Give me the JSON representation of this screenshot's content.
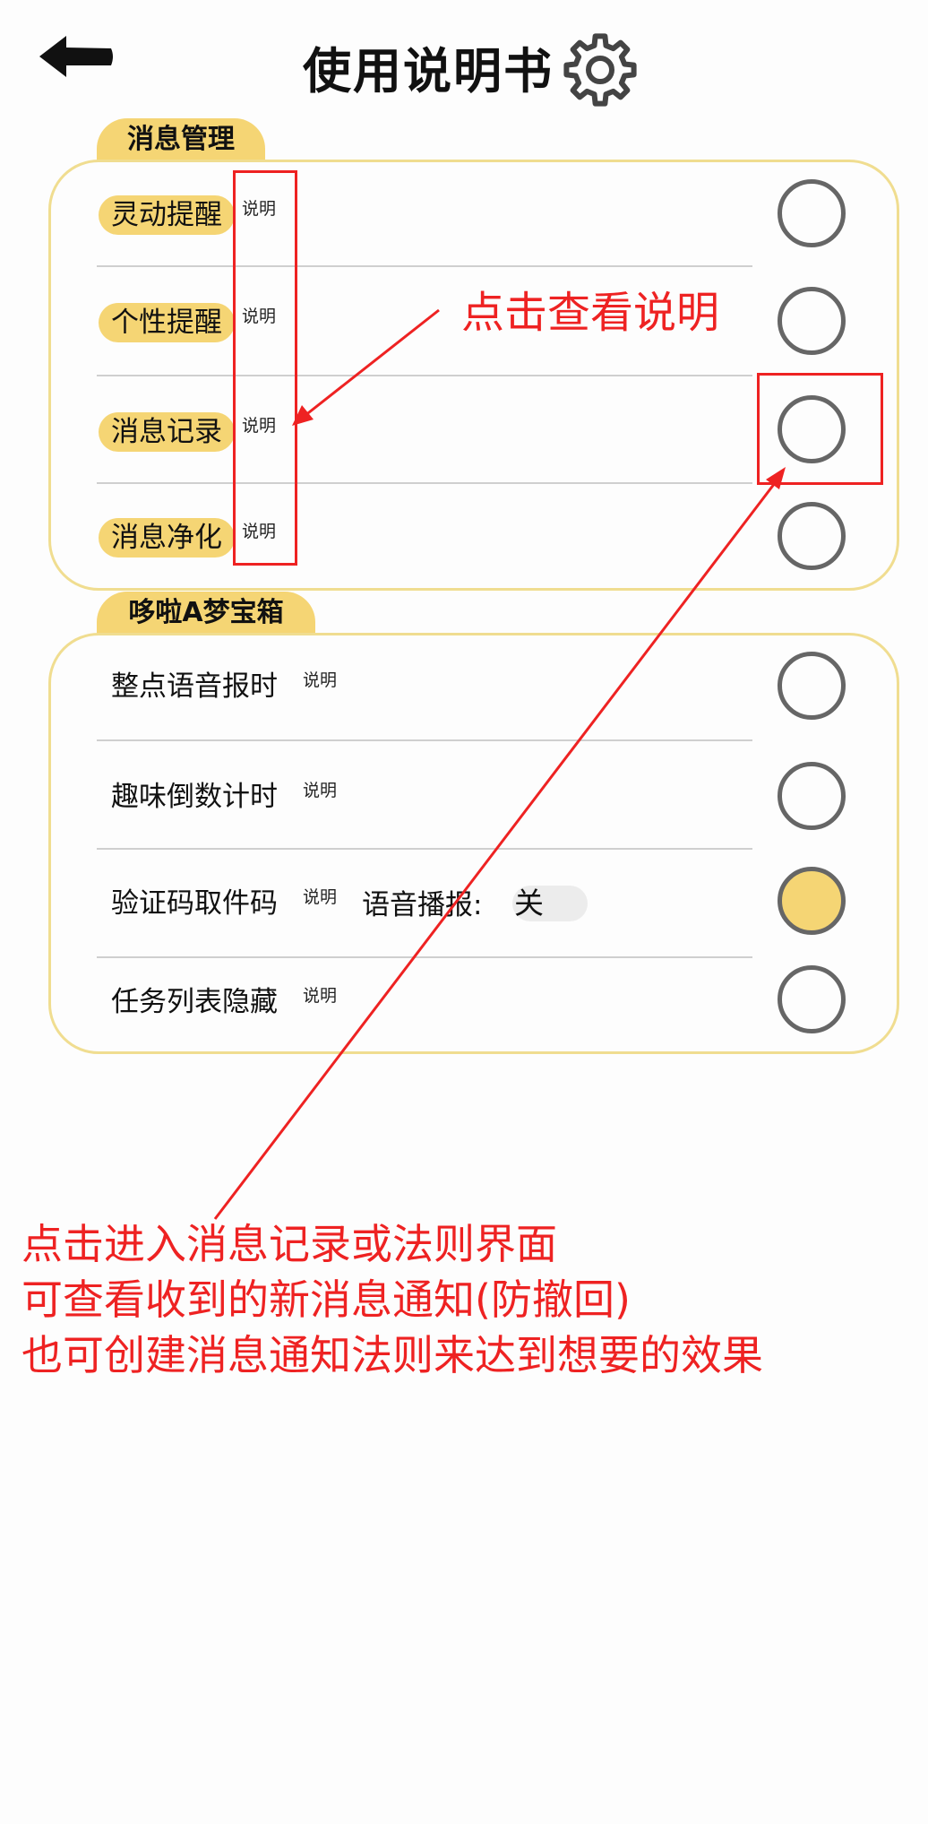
{
  "header": {
    "title": "使用说明书",
    "back_icon": "arrow-left-icon",
    "settings_icon": "gear-icon"
  },
  "sections": [
    {
      "tab_label": "消息管理",
      "rows": [
        {
          "label": "灵动提醒",
          "explain": "说明",
          "checked": false
        },
        {
          "label": "个性提醒",
          "explain": "说明",
          "checked": false
        },
        {
          "label": "消息记录",
          "explain": "说明",
          "checked": false
        },
        {
          "label": "消息净化",
          "explain": "说明",
          "checked": false
        }
      ]
    },
    {
      "tab_label": "哆啦A梦宝箱",
      "rows": [
        {
          "label": "整点语音报时",
          "explain": "说明",
          "checked": false
        },
        {
          "label": "趣味倒数计时",
          "explain": "说明",
          "checked": false
        },
        {
          "label": "验证码取件码",
          "explain": "说明",
          "checked": true,
          "toggle_label": "语音播报:",
          "toggle_value": "关"
        },
        {
          "label": "任务列表隐藏",
          "explain": "说明",
          "checked": false
        }
      ]
    }
  ],
  "annotations": {
    "callout": "点击查看说明",
    "lines": [
      "点击进入消息记录或法则界面",
      "可查看收到的新消息通知(防撤回)",
      "也可创建消息通知法则来达到想要的效果"
    ]
  },
  "colors": {
    "accent_yellow": "#f5d574",
    "card_border": "#f0dd90",
    "annotation_red": "#ee2222"
  }
}
